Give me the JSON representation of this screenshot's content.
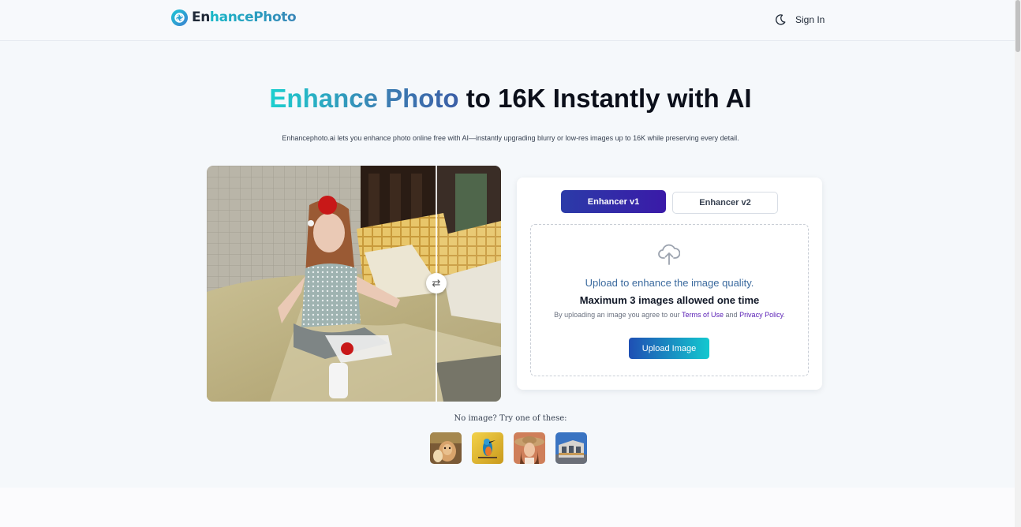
{
  "header": {
    "logo_prefix": "En",
    "logo_suffix": "hancePhoto",
    "theme_toggle_icon": "moon-icon",
    "signin_label": "Sign In"
  },
  "hero": {
    "title_highlight": "Enhance Photo",
    "title_rest": " to 16K Instantly with AI",
    "subtitle": "Enhancephoto.ai lets you enhance photo online free with AI—instantly upgrading blurry or low-res images up to 16K while preserving every detail."
  },
  "compare": {
    "slider_icon": "swap-arrows-icon",
    "slider_glyph": "⇄",
    "slider_position_percent": 78
  },
  "upload_card": {
    "tabs": [
      {
        "label": "Enhancer v1",
        "active": true
      },
      {
        "label": "Enhancer v2",
        "active": false
      }
    ],
    "icon": "cloud-upload-icon",
    "line1": "Upload to enhance the image quality.",
    "line2": "Maximum 3 images allowed one time",
    "terms_prefix": "By uploading an image you agree to our ",
    "terms_link": "Terms of Use",
    "terms_mid": " and ",
    "privacy_link": "Privacy Policy",
    "terms_suffix": ".",
    "button_label": "Upload Image"
  },
  "samples": {
    "label": "No image? Try one of these:",
    "items": [
      "dog-sample",
      "kingfisher-sample",
      "woman-hat-sample",
      "building-sample"
    ]
  },
  "colors": {
    "accent_cyan": "#17b7c7",
    "accent_indigo": "#2b3ba8",
    "link_purple": "#5b21b6"
  }
}
